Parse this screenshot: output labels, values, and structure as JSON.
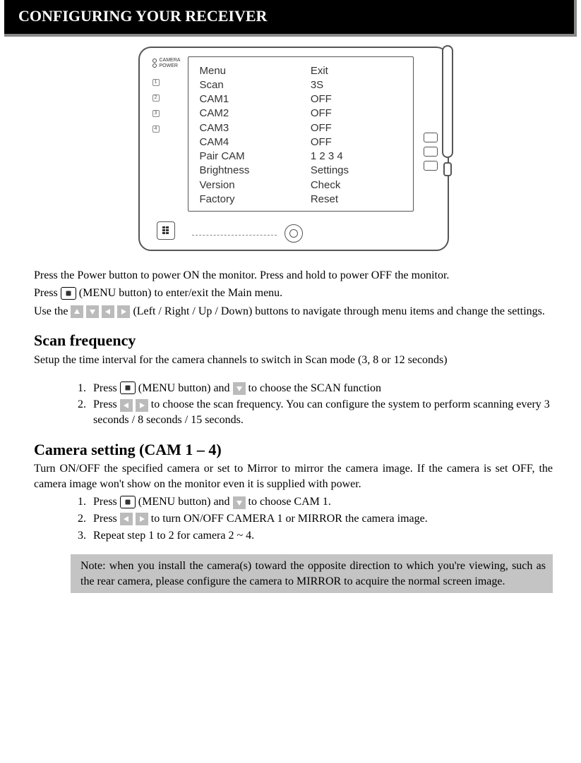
{
  "title": "CONFIGURING YOUR RECEIVER",
  "device": {
    "labels": {
      "camera": "CAMERA",
      "power": "POWER"
    },
    "side_numbers": [
      "1",
      "2",
      "3",
      "4"
    ],
    "menu": [
      {
        "l": "Menu",
        "r": "Exit"
      },
      {
        "l": "Scan",
        "r": "3S"
      },
      {
        "l": "CAM1",
        "r": "OFF"
      },
      {
        "l": "CAM2",
        "r": "OFF"
      },
      {
        "l": "CAM3",
        "r": "OFF"
      },
      {
        "l": "CAM4",
        "r": "OFF"
      },
      {
        "l": "Pair CAM",
        "r": "1  2  3  4"
      },
      {
        "l": "Brightness",
        "r": "Settings"
      },
      {
        "l": "Version",
        "r": "Check"
      },
      {
        "l": "Factory",
        "r": "Reset"
      }
    ]
  },
  "intro": {
    "p1": "Press the Power button to power ON the monitor. Press and hold to power OFF the monitor.",
    "p2a": "Press ",
    "p2b": " (MENU button) to enter/exit the Main menu.",
    "p3a": "Use the ",
    "p3b": " (Left / Right / Up / Down) buttons to navigate through menu items and change the settings."
  },
  "scan": {
    "heading": "Scan frequency",
    "desc": "Setup the time interval for the camera channels to switch in Scan mode (3, 8 or 12 seconds)",
    "step1a": "Press ",
    "step1b": " (MENU button) and ",
    "step1c": " to choose the SCAN function",
    "step2a": "Press ",
    "step2b": " to choose the scan frequency. You can configure the system to perform scanning every 3 seconds / 8 seconds / 15 seconds."
  },
  "cam": {
    "heading": "Camera setting (CAM 1 – 4)",
    "desc": "Turn ON/OFF the specified camera or set to Mirror to mirror the camera image. If the camera is set OFF, the camera image won't show on the monitor even it is supplied with power.",
    "step1a": "Press ",
    "step1b": " (MENU button) and ",
    "step1c": " to choose CAM 1.",
    "step2a": "Press ",
    "step2b": " to turn ON/OFF CAMERA 1 or MIRROR the camera image.",
    "step3": "Repeat step 1 to 2 for camera 2 ~ 4."
  },
  "note": "Note: when you install the camera(s) toward the opposite direction to which you're viewing, such as the rear camera, please configure the camera to MIRROR to acquire the normal screen image."
}
